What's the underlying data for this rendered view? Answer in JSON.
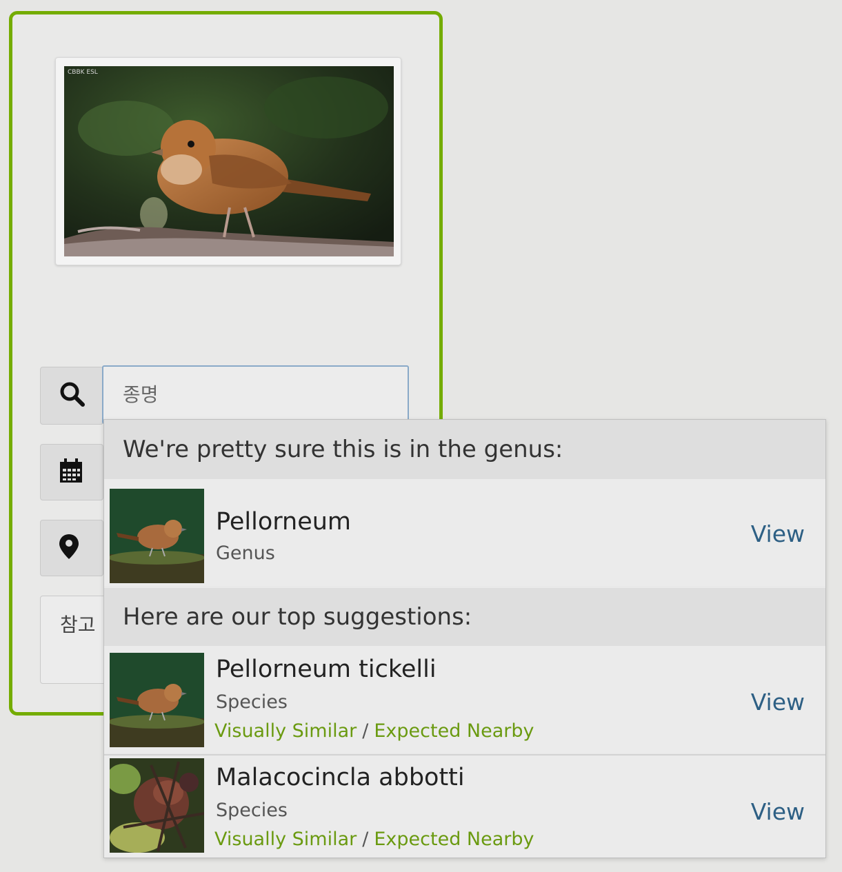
{
  "search": {
    "placeholder": "종명"
  },
  "photo": {
    "watermark": "CBBK ESL"
  },
  "notes": {
    "label": "참고"
  },
  "dropdown": {
    "genus_heading": "We're pretty sure this is in the genus:",
    "top_heading": "Here are our top suggestions:",
    "genus": {
      "name": "Pellorneum",
      "rank": "Genus",
      "view_label": "View"
    },
    "suggestions": [
      {
        "name": "Pellorneum tickelli",
        "rank": "Species",
        "reason_a": "Visually Similar",
        "sep": "/",
        "reason_b": "Expected Nearby",
        "view_label": "View"
      },
      {
        "name": "Malacocincla abbotti",
        "rank": "Species",
        "reason_a": "Visually Similar",
        "sep": "/",
        "reason_b": "Expected Nearby",
        "view_label": "View"
      }
    ]
  },
  "colors": {
    "accent_green": "#74ac00",
    "link_blue": "#2d5f84",
    "reason_green": "#6a9a10"
  },
  "icons": [
    "search-icon",
    "calendar-icon",
    "location-pin-icon"
  ]
}
